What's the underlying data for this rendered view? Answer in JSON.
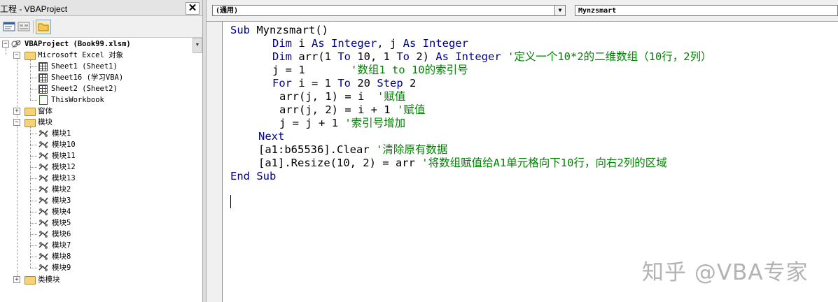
{
  "project_pane": {
    "title": "工程 - VBAProject",
    "close_glyph": "✕",
    "toolbar": {
      "view_code_icon": "view-code-icon",
      "view_object_icon": "view-object-icon",
      "toggle_folders_icon": "folder-icon",
      "scroll_handle_glyph": "▼"
    },
    "tree": {
      "project": "VBAProject (Book99.xlsm)",
      "excel_objects_folder": "Microsoft Excel 对象",
      "sheets": [
        "Sheet1 (Sheet1)",
        "Sheet16 (学习VBA)",
        "Sheet2 (Sheet2)",
        "ThisWorkbook"
      ],
      "forms_folder": "窗体",
      "modules_folder": "模块",
      "modules": [
        "模块1",
        "模块10",
        "模块11",
        "模块12",
        "模块13",
        "模块2",
        "模块3",
        "模块4",
        "模块5",
        "模块6",
        "模块7",
        "模块8",
        "模块9"
      ],
      "class_modules_folder": "类模块"
    },
    "expanders": {
      "minus": "−",
      "plus": "+"
    }
  },
  "code_window": {
    "object_combo": "(通用)",
    "procedure_combo": "Mynzsmart",
    "combo_arrow": "▼",
    "code": {
      "l1_kw": "Sub",
      "l1_rest": " Mynzsmart()",
      "l2_kw1": "Dim",
      "l2_a": " i ",
      "l2_kw2": "As Integer",
      "l2_b": ", j ",
      "l2_kw3": "As Integer",
      "l3_kw1": "Dim",
      "l3_a": " arr(1 ",
      "l3_kw2": "To",
      "l3_b": " 10, 1 ",
      "l3_kw3": "To",
      "l3_c": " 2) ",
      "l3_kw4": "As Integer",
      "l3_cm": " '定义一个10*2的二维数组（10行，2列）",
      "l4_code": "j = 1       ",
      "l4_cm": "'数组1 to 10的索引号",
      "l5_kw1": "For",
      "l5_a": " i = 1 ",
      "l5_kw2": "To",
      "l5_b": " 20 ",
      "l5_kw3": "Step",
      "l5_c": " 2",
      "l6_code": "arr(j, 1) = i  ",
      "l6_cm": "'赋值",
      "l7_code": "arr(j, 2) = i + 1 ",
      "l7_cm": "'赋值",
      "l8_code": "j = j + 1 ",
      "l8_cm": "'索引号增加",
      "l9_kw": "Next",
      "l10_code": "[a1:b65536].Clear ",
      "l10_cm": "'清除原有数据",
      "l11_code": "[a1].Resize(10, 2) = arr ",
      "l11_cm": "'将数组赋值给A1单元格向下10行，向右2列的区域",
      "l12_kw": "End Sub"
    }
  },
  "watermark": "知乎 @VBA专家",
  "colors": {
    "keyword": "#00008b",
    "comment": "#008000",
    "chrome": "#f0f0f0"
  }
}
